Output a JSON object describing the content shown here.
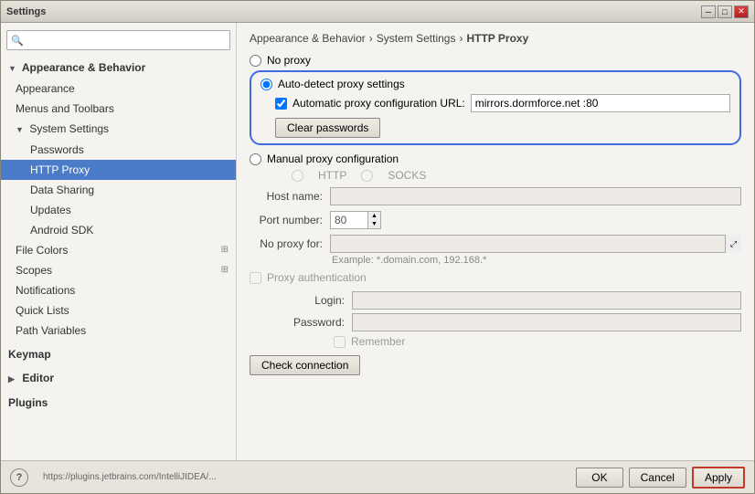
{
  "window": {
    "title": "Settings"
  },
  "breadcrumb": {
    "part1": "Appearance & Behavior",
    "sep1": "›",
    "part2": "System Settings",
    "sep2": "›",
    "part3": "HTTP Proxy"
  },
  "proxy": {
    "no_proxy_label": "No proxy",
    "auto_detect_label": "Auto-detect proxy settings",
    "auto_config_label": "Automatic proxy configuration URL:",
    "proxy_url_value": "mirrors.dormforce.net :80",
    "clear_passwords_label": "Clear passwords",
    "manual_label": "Manual proxy configuration",
    "http_label": "HTTP",
    "socks_label": "SOCKS",
    "host_label": "Host name:",
    "port_label": "Port number:",
    "port_value": "80",
    "no_proxy_for_label": "No proxy for:",
    "example_text": "Example: *.domain.com, 192.168.*",
    "proxy_auth_label": "Proxy authentication",
    "login_label": "Login:",
    "password_label": "Password:",
    "remember_label": "Remember",
    "check_connection_label": "Check connection"
  },
  "sidebar": {
    "search_placeholder": "🔍",
    "items": [
      {
        "id": "appearance-behavior",
        "label": "Appearance & Behavior",
        "level": "section",
        "expanded": true
      },
      {
        "id": "appearance",
        "label": "Appearance",
        "level": "subsection"
      },
      {
        "id": "menus-toolbars",
        "label": "Menus and Toolbars",
        "level": "subsection"
      },
      {
        "id": "system-settings",
        "label": "System Settings",
        "level": "subsection",
        "expanded": true
      },
      {
        "id": "passwords",
        "label": "Passwords",
        "level": "subsubsection"
      },
      {
        "id": "http-proxy",
        "label": "HTTP Proxy",
        "level": "subsubsection",
        "selected": true
      },
      {
        "id": "data-sharing",
        "label": "Data Sharing",
        "level": "subsubsection"
      },
      {
        "id": "updates",
        "label": "Updates",
        "level": "subsubsection"
      },
      {
        "id": "android-sdk",
        "label": "Android SDK",
        "level": "subsubsection"
      },
      {
        "id": "file-colors",
        "label": "File Colors",
        "level": "subsection"
      },
      {
        "id": "scopes",
        "label": "Scopes",
        "level": "subsection"
      },
      {
        "id": "notifications",
        "label": "Notifications",
        "level": "subsection"
      },
      {
        "id": "quick-lists",
        "label": "Quick Lists",
        "level": "subsection"
      },
      {
        "id": "path-variables",
        "label": "Path Variables",
        "level": "subsection"
      },
      {
        "id": "keymap",
        "label": "Keymap",
        "level": "section"
      },
      {
        "id": "editor",
        "label": "Editor",
        "level": "section",
        "collapsed": true
      },
      {
        "id": "plugins",
        "label": "Plugins",
        "level": "section"
      }
    ]
  },
  "bottom": {
    "url_text": "https://plugins.jetbrains.com/IntelliJIDEA/...",
    "ok_label": "OK",
    "cancel_label": "Cancel",
    "apply_label": "Apply"
  }
}
